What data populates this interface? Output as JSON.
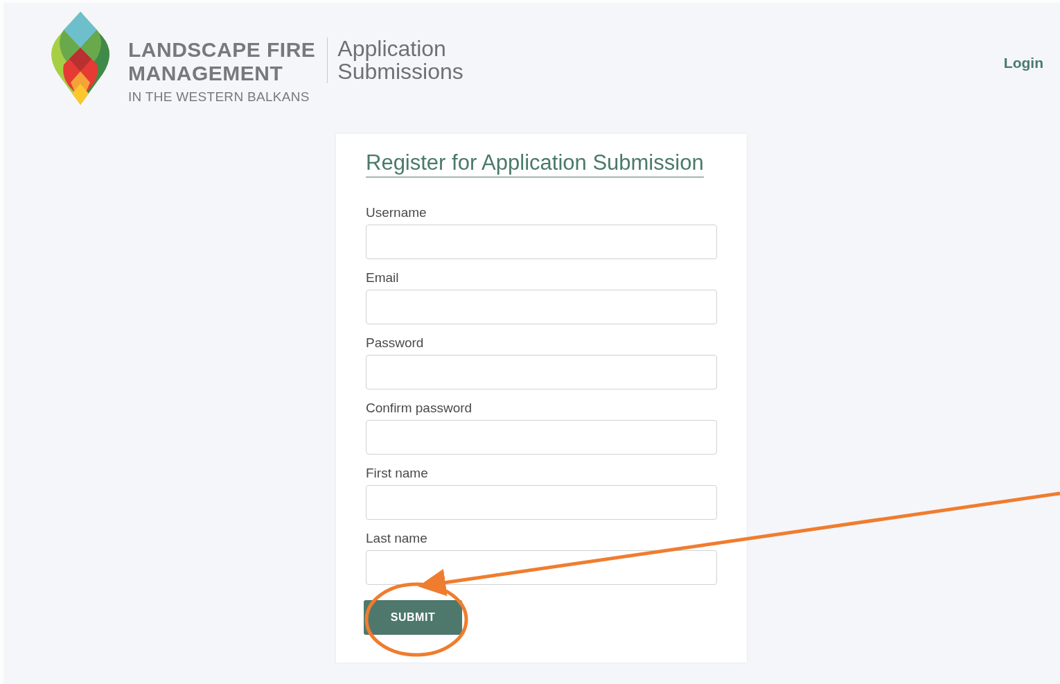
{
  "header": {
    "brand_line_1": "LANDSCAPE FIRE",
    "brand_line_2": "MANAGEMENT",
    "brand_tagline": "IN THE WESTERN BALKANS",
    "app_title_line_1": "Application",
    "app_title_line_2": "Submissions",
    "login_link": "Login"
  },
  "form": {
    "title": "Register for Application Submission",
    "fields": [
      {
        "label": "Username"
      },
      {
        "label": "Email"
      },
      {
        "label": "Password"
      },
      {
        "label": "Confirm password"
      },
      {
        "label": "First name"
      },
      {
        "label": "Last name"
      }
    ],
    "submit_button": "SUBMIT"
  }
}
